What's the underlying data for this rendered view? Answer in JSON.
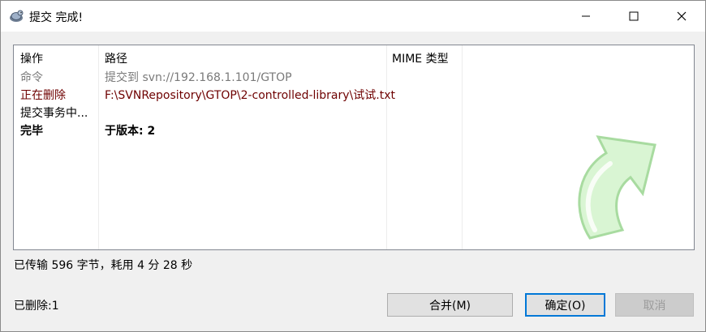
{
  "window": {
    "title": "提交 完成!"
  },
  "columns": {
    "action": "操作",
    "path": "路径",
    "mime": "MIME 类型"
  },
  "rows": [
    {
      "action": "命令",
      "path": "提交到 svn://192.168.1.101/GTOP",
      "style": "gray"
    },
    {
      "action": "正在删除",
      "path": "F:\\SVNRepository\\GTOP\\2-controlled-library\\试试.txt",
      "style": "red"
    },
    {
      "action": "提交事务中...",
      "path": "",
      "style": "normal"
    },
    {
      "action": "完毕",
      "path": "于版本: 2",
      "style": "bold"
    }
  ],
  "status": {
    "transfer": "已传输 596 字节，耗用 4 分 28 秒",
    "deleted": "已删除:1"
  },
  "buttons": {
    "merge": "合并(M)",
    "ok": "确定(O)",
    "cancel": "取消"
  },
  "colors": {
    "row_gray": "#7a7a7a",
    "row_red": "#6e0000",
    "default_button_border": "#0078d7"
  },
  "icons": {
    "app": "tortoise-svn-icon",
    "watermark": "green-curved-arrow"
  }
}
